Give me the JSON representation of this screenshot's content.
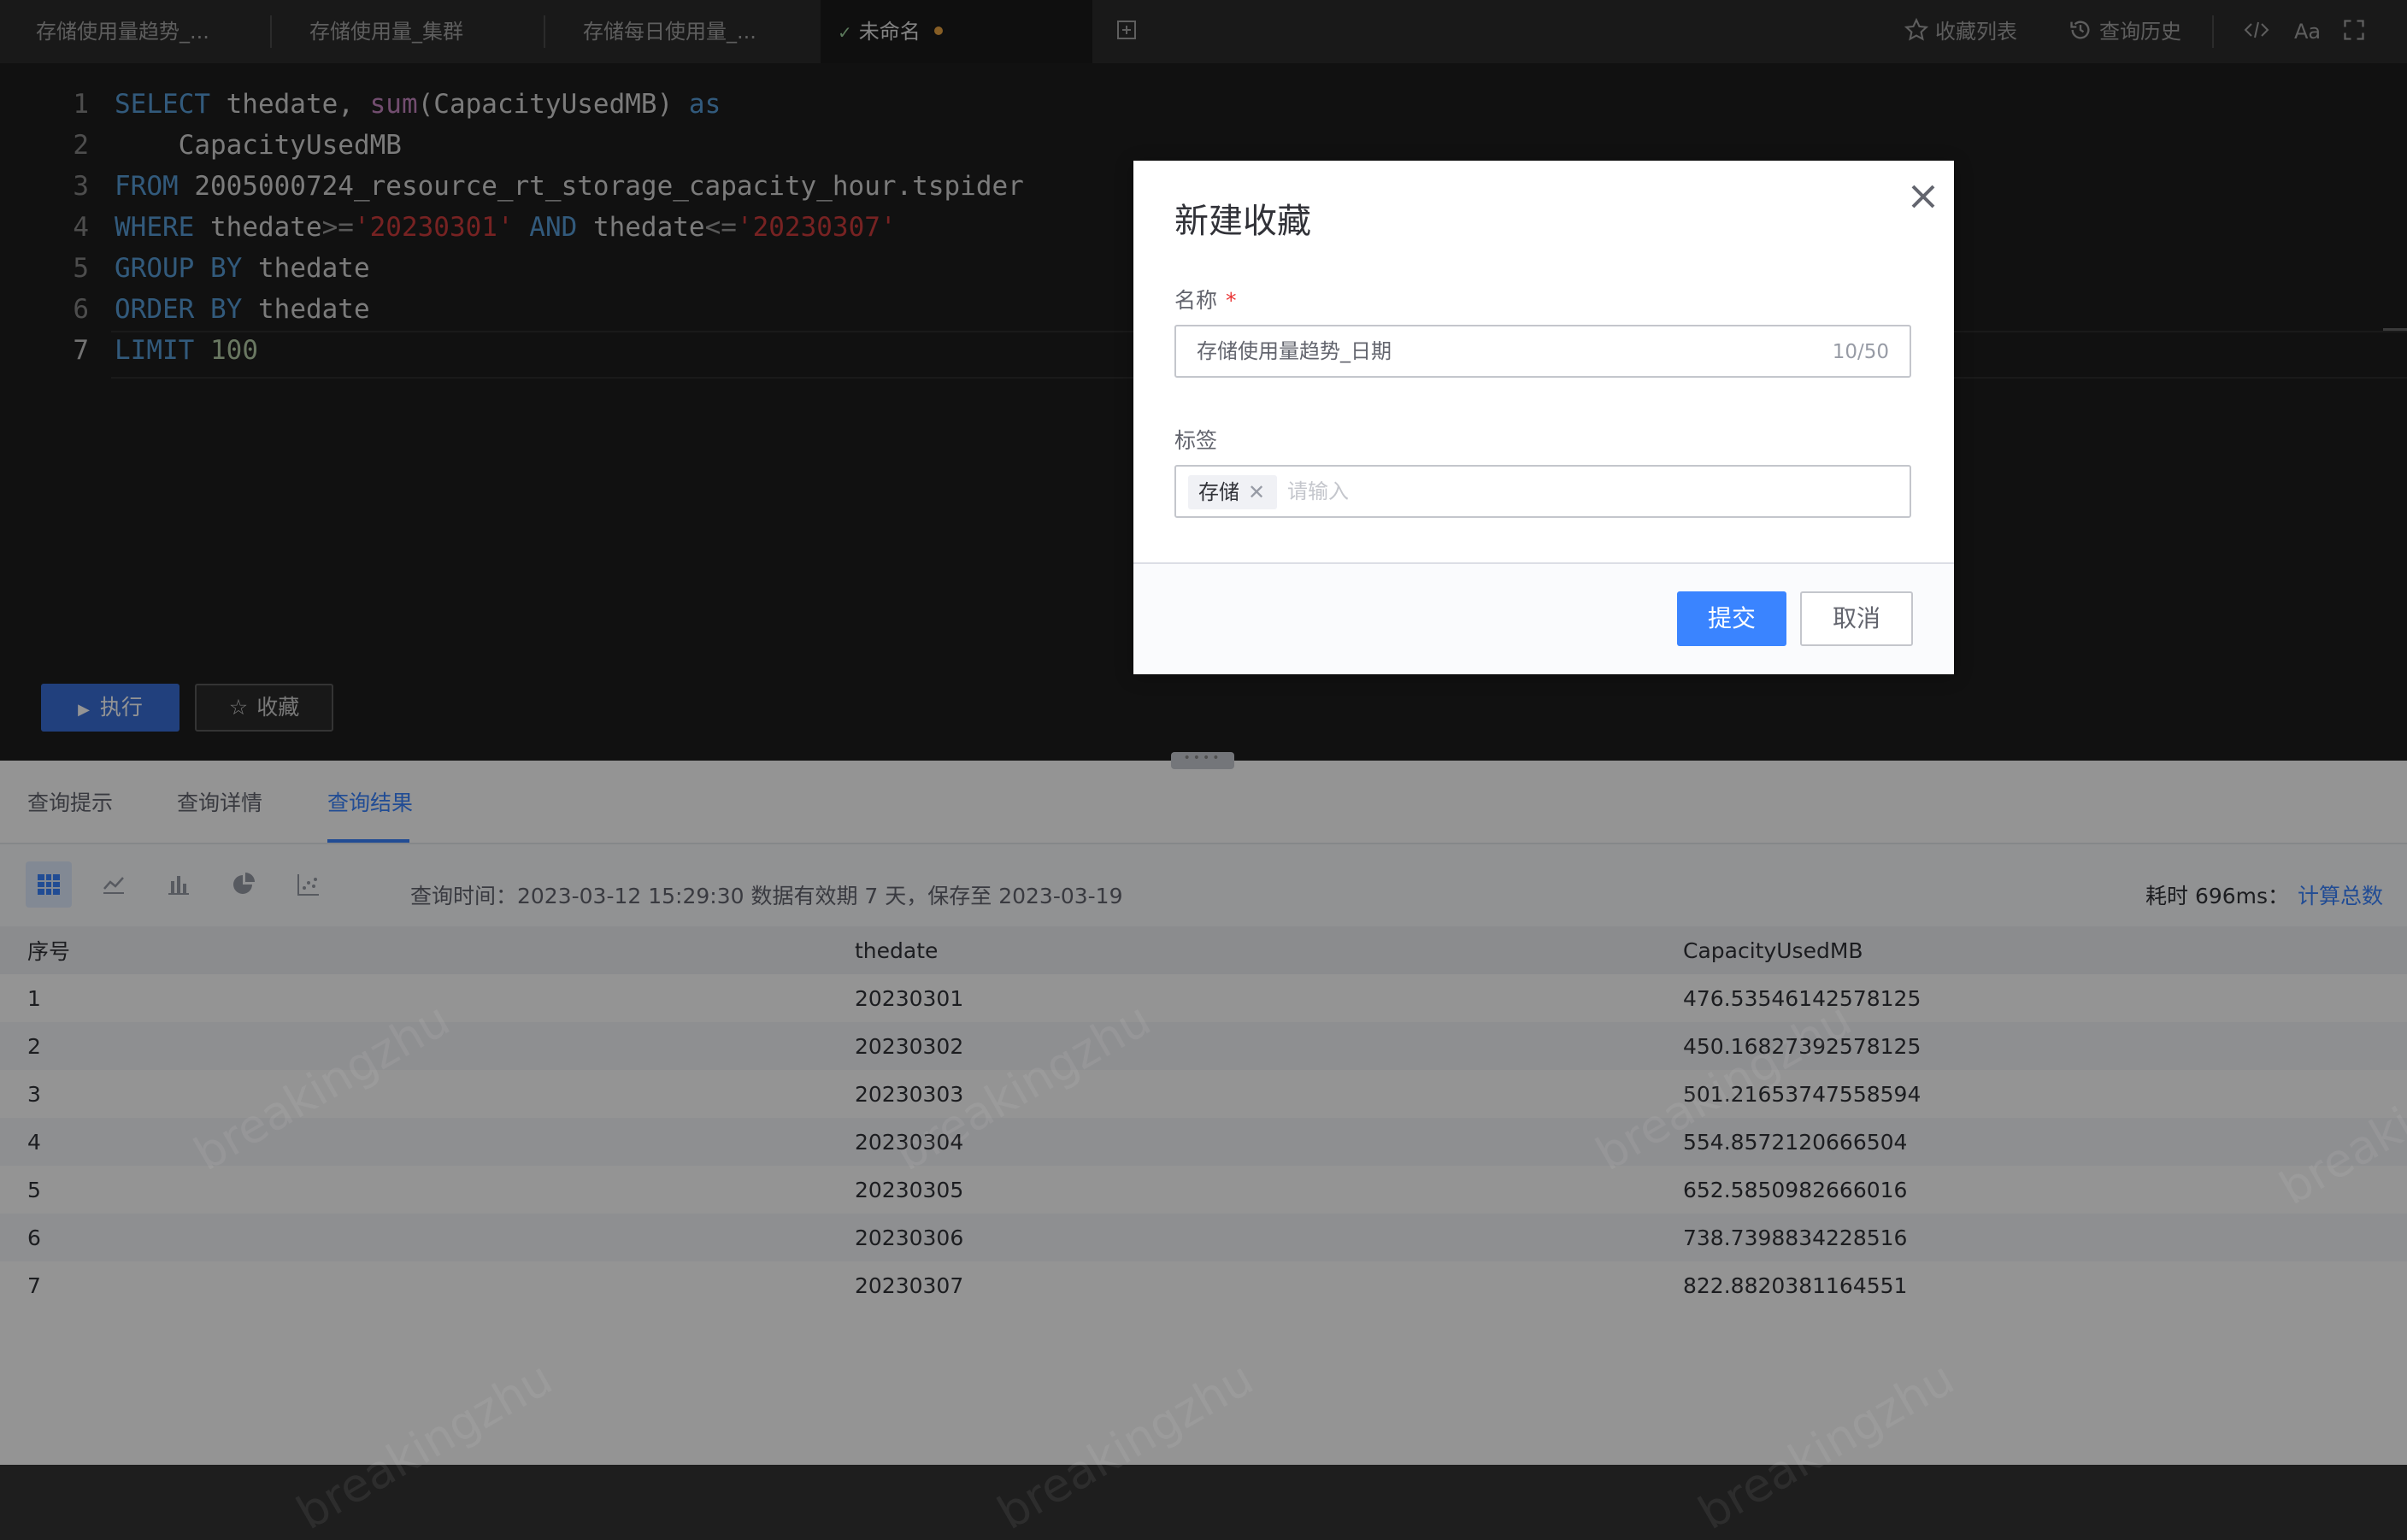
{
  "tabs": [
    {
      "label": "存储使用量趋势_..."
    },
    {
      "label": "存储使用量_集群"
    },
    {
      "label": "存储每日使用量_..."
    },
    {
      "label": "未命名",
      "active": true,
      "unsaved": true
    }
  ],
  "toolbar": {
    "favorites_label": "收藏列表",
    "history_label": "查询历史",
    "font_label": "Aa"
  },
  "editor": {
    "line_numbers": [
      "1",
      "2",
      "3",
      "4",
      "5",
      "6",
      "7"
    ],
    "lines": [
      "SELECT thedate, sum(CapacityUsedMB) as",
      "    CapacityUsedMB",
      "FROM 2005000724_resource_rt_storage_capacity_hour.tspider",
      "WHERE thedate>='20230301' AND thedate<='20230307'",
      "GROUP BY thedate",
      "ORDER BY thedate",
      "LIMIT 100"
    ],
    "run_label": "执行",
    "fav_label": "收藏"
  },
  "results": {
    "tabs": [
      "查询提示",
      "查询详情",
      "查询结果"
    ],
    "active_tab": "查询结果",
    "meta": "查询时间：2023-03-12 15:29:30 数据有效期 7 天，保存至 2023-03-19",
    "cost": "耗时 696ms：",
    "calc_total": "计算总数",
    "columns": [
      "序号",
      "thedate",
      "CapacityUsedMB"
    ],
    "rows": [
      [
        "1",
        "20230301",
        "476.53546142578125"
      ],
      [
        "2",
        "20230302",
        "450.16827392578125"
      ],
      [
        "3",
        "20230303",
        "501.21653747558594"
      ],
      [
        "4",
        "20230304",
        "554.8572120666504"
      ],
      [
        "5",
        "20230305",
        "652.5850982666016"
      ],
      [
        "6",
        "20230306",
        "738.7398834228516"
      ],
      [
        "7",
        "20230307",
        "822.8820381164551"
      ]
    ],
    "watermark": "breakingzhu"
  },
  "modal": {
    "title": "新建收藏",
    "name_label": "名称",
    "required_mark": "*",
    "name_value": "存储使用量趋势_日期",
    "name_counter": "10/50",
    "tag_label": "标签",
    "tag_chip": "存储",
    "tag_placeholder": "请输入",
    "submit_label": "提交",
    "cancel_label": "取消"
  },
  "colors": {
    "accent": "#3a84ff",
    "run_button": "#3a6fd8",
    "unsaved_dot": "#e8a340"
  }
}
